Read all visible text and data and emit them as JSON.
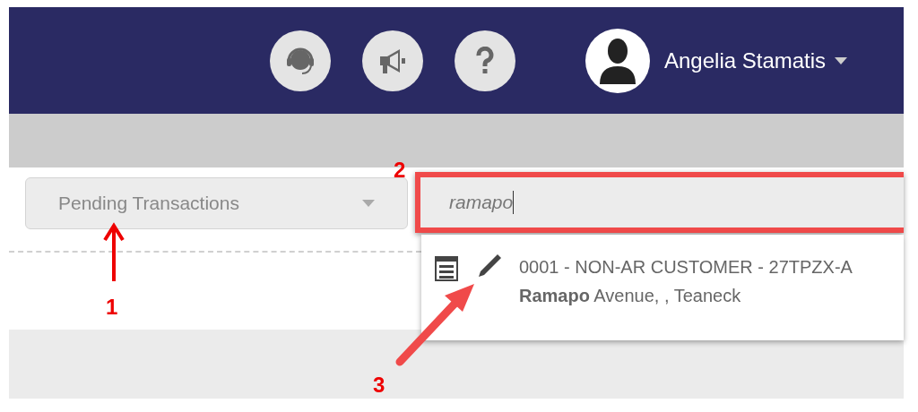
{
  "user": {
    "name": "Angelia Stamatis"
  },
  "filter": {
    "value": "Pending Transactions"
  },
  "search": {
    "value": "ramapo",
    "highlighted": true
  },
  "results": [
    {
      "title": "0001 - NON-AR CUSTOMER - 27TPZX-A",
      "address": "**Ramapo** Avenue, , Teaneck"
    }
  ],
  "annotations": [
    {
      "label": "1"
    },
    {
      "label": "2"
    },
    {
      "label": "3"
    }
  ]
}
